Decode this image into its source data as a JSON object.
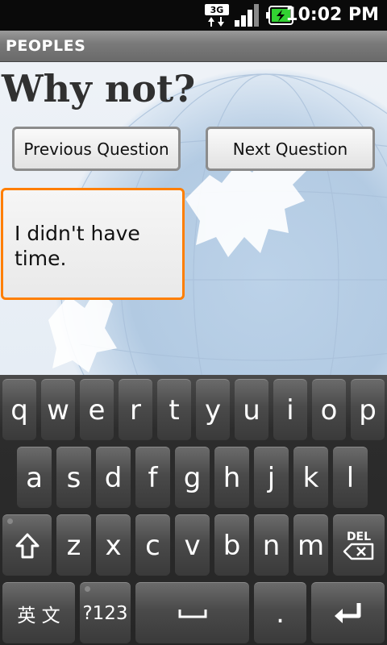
{
  "status_bar": {
    "time": "10:02 PM",
    "network": "3G"
  },
  "title_bar": {
    "title": "PEOPLES"
  },
  "main": {
    "question": "Why not?",
    "previous_button": "Previous Question",
    "next_button": "Next Question",
    "answer_text": "I didn't have time."
  },
  "keyboard": {
    "row1": [
      "q",
      "w",
      "e",
      "r",
      "t",
      "y",
      "u",
      "i",
      "o",
      "p"
    ],
    "row2": [
      "a",
      "s",
      "d",
      "f",
      "g",
      "h",
      "j",
      "k",
      "l"
    ],
    "row3": [
      "z",
      "x",
      "c",
      "v",
      "b",
      "n",
      "m"
    ],
    "shift_icon": "shift-icon",
    "del_label": "DEL",
    "lang_label": "英 文",
    "symbols_label": "?123",
    "space_icon": "space-icon",
    "period_label": ".",
    "enter_icon": "enter-icon"
  },
  "colors": {
    "focus_border": "#ff7f00",
    "title_bar": "#7a7a7a"
  }
}
